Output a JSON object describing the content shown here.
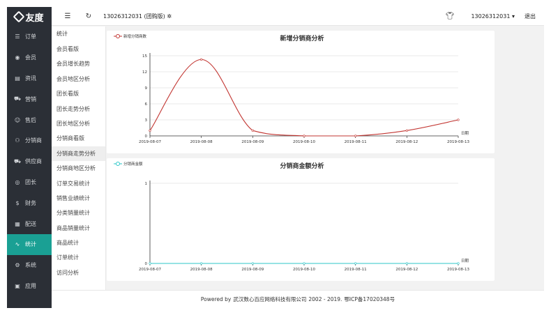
{
  "app": {
    "logo_text": "友度"
  },
  "sidebar": {
    "items": [
      {
        "label": "订单",
        "icon": "list-icon",
        "glyph": "☰",
        "active": false
      },
      {
        "label": "会员",
        "icon": "user-icon",
        "glyph": "◉",
        "active": false
      },
      {
        "label": "资讯",
        "icon": "news-icon",
        "glyph": "▤",
        "active": false
      },
      {
        "label": "营销",
        "icon": "cart-icon",
        "glyph": "⛟",
        "active": false
      },
      {
        "label": "售后",
        "icon": "smile-icon",
        "glyph": "☺",
        "active": false
      },
      {
        "label": "分销商",
        "icon": "users-icon",
        "glyph": "⚇",
        "active": false
      },
      {
        "label": "供应商",
        "icon": "cart-icon",
        "glyph": "⛟",
        "active": false
      },
      {
        "label": "团长",
        "icon": "person-icon",
        "glyph": "◎",
        "active": false
      },
      {
        "label": "财务",
        "icon": "coin-icon",
        "glyph": "$",
        "active": false
      },
      {
        "label": "配送",
        "icon": "calendar-icon",
        "glyph": "▦",
        "active": false
      },
      {
        "label": "统计",
        "icon": "pulse-icon",
        "glyph": "∿",
        "active": true
      },
      {
        "label": "系统",
        "icon": "settings-icon",
        "glyph": "⚙",
        "active": false
      },
      {
        "label": "应用",
        "icon": "app-icon",
        "glyph": "▣",
        "active": false
      }
    ]
  },
  "header": {
    "title": "13026312031 (团购版)",
    "user": "13026312031",
    "logout": "退出"
  },
  "submenu": {
    "title": "统计",
    "items": [
      {
        "label": "会员看版",
        "active": false
      },
      {
        "label": "会员增长趋势",
        "active": false
      },
      {
        "label": "会员地区分析",
        "active": false
      },
      {
        "label": "团长看版",
        "active": false
      },
      {
        "label": "团长走势分析",
        "active": false
      },
      {
        "label": "团长地区分析",
        "active": false
      },
      {
        "label": "分销商看版",
        "active": false
      },
      {
        "label": "分销商走势分析",
        "active": true
      },
      {
        "label": "分销商地区分析",
        "active": false
      },
      {
        "label": "订单交易统计",
        "active": false
      },
      {
        "label": "销售业绩统计",
        "active": false
      },
      {
        "label": "分类销量统计",
        "active": false
      },
      {
        "label": "商品销量统计",
        "active": false
      },
      {
        "label": "商品统计",
        "active": false
      },
      {
        "label": "订单统计",
        "active": false
      },
      {
        "label": "访问分析",
        "active": false
      }
    ]
  },
  "chart_data": [
    {
      "type": "line",
      "title": "新增分销商分析",
      "xlabel": "日期",
      "ylabel": "",
      "categories": [
        "2019-08-07",
        "2019-08-08",
        "2019-08-09",
        "2019-08-10",
        "2019-08-11",
        "2019-08-12",
        "2019-08-13"
      ],
      "series": [
        {
          "name": "新增分销商数",
          "values": [
            1,
            14.3,
            1,
            0,
            0,
            1,
            3
          ],
          "color": "#c23531"
        }
      ],
      "yticks": [
        0,
        3,
        6,
        9,
        12,
        15
      ],
      "ylim": [
        0,
        15
      ],
      "grid": true,
      "legend": "top-left"
    },
    {
      "type": "line",
      "title": "分销商金额分析",
      "xlabel": "日期",
      "ylabel": "",
      "categories": [
        "2019-08-07",
        "2019-08-08",
        "2019-08-09",
        "2019-08-10",
        "2019-08-11",
        "2019-08-12",
        "2019-08-13"
      ],
      "series": [
        {
          "name": "分销商金额",
          "values": [
            0,
            0,
            0,
            0,
            0,
            0,
            0
          ],
          "color": "#2ec7c9"
        }
      ],
      "yticks": [
        0,
        1
      ],
      "ylim": [
        0,
        1
      ],
      "grid": true,
      "legend": "top-left"
    }
  ],
  "footer": {
    "prefix": "Powered by",
    "company": "武汉数心百应网络科技有限公司",
    "years": "2002 - 2019.",
    "icp": "鄂ICP备17020348号"
  }
}
